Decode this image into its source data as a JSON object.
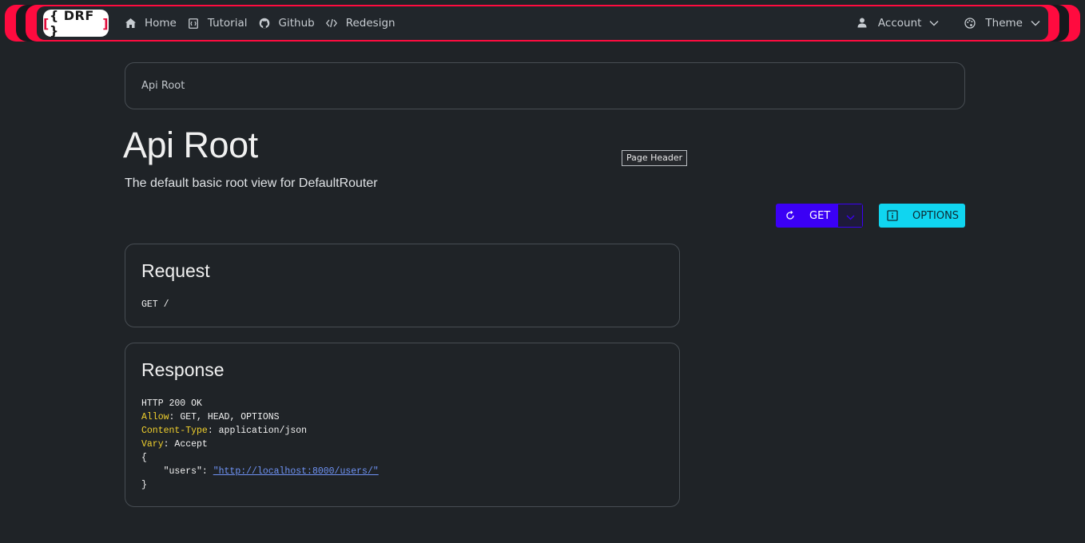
{
  "navbar": {
    "brand": {
      "open": "[",
      "text": "{ DRF }",
      "close": "]"
    },
    "items": [
      {
        "label": "Home",
        "icon": "home-icon"
      },
      {
        "label": "Tutorial",
        "icon": "book-icon"
      },
      {
        "label": "Github",
        "icon": "github-icon"
      },
      {
        "label": "Redesign",
        "icon": "code-icon"
      }
    ],
    "account": {
      "label": "Account",
      "icon": "user-icon"
    },
    "theme": {
      "label": "Theme",
      "icon": "palette-icon"
    }
  },
  "breadcrumb": {
    "label": "Api Root"
  },
  "page": {
    "title": "Api Root",
    "description": "The default basic root view for DefaultRouter",
    "tooltip": "Page Header"
  },
  "actions": {
    "get_label": "GET",
    "options_label": "OPTIONS"
  },
  "request": {
    "title": "Request",
    "line": "GET /"
  },
  "response": {
    "title": "Response",
    "status": "HTTP 200 OK",
    "headers": [
      {
        "key": "Allow",
        "value": "GET, HEAD, OPTIONS"
      },
      {
        "key": "Content-Type",
        "value": "application/json"
      },
      {
        "key": "Vary",
        "value": "Accept"
      }
    ],
    "body_open": "{",
    "body_key": "    \"users\": ",
    "body_link": "\"http://localhost:8000/users/\"",
    "body_close": "}"
  },
  "colors": {
    "accent_red": "#ff0b3f",
    "get_button": "#3b00f5",
    "options_button": "#10d5f0",
    "header_key": "#f2d12d",
    "link": "#6f93f5"
  }
}
